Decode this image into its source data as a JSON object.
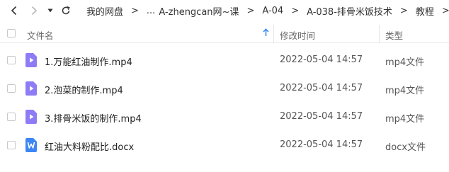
{
  "toolbar": {
    "back_icon": "chevron-left-icon",
    "forward_icon": "chevron-right-icon",
    "history_icon": "caret-down-icon",
    "refresh_icon": "refresh-icon"
  },
  "breadcrumb": {
    "items": [
      "我的网盘",
      "...",
      "A-zhengcan网~课",
      "A-04",
      "A-038-排骨米饭技术",
      "教程"
    ],
    "separator": ">"
  },
  "header": {
    "name": "文件名",
    "modified": "修改时间",
    "type": "类型",
    "sort_icon": "arrow-up-icon",
    "sort_color": "#3b8cf3"
  },
  "files": [
    {
      "name": "1.万能红油制作.mp4",
      "time": "2022-05-04 14:57",
      "type": "mp4文件",
      "icon": "video-file-icon"
    },
    {
      "name": "2.泡菜的制作.mp4",
      "time": "2022-05-04 14:57",
      "type": "mp4文件",
      "icon": "video-file-icon"
    },
    {
      "name": "3.排骨米饭的制作.mp4",
      "time": "2022-05-04 14:57",
      "type": "mp4文件",
      "icon": "video-file-icon"
    },
    {
      "name": "红油大料粉配比.docx",
      "time": "2022-05-04 14:57",
      "type": "docx文件",
      "icon": "word-file-icon"
    }
  ],
  "colors": {
    "video_icon": "#8d7cf6",
    "word_icon": "#3d86f4"
  }
}
